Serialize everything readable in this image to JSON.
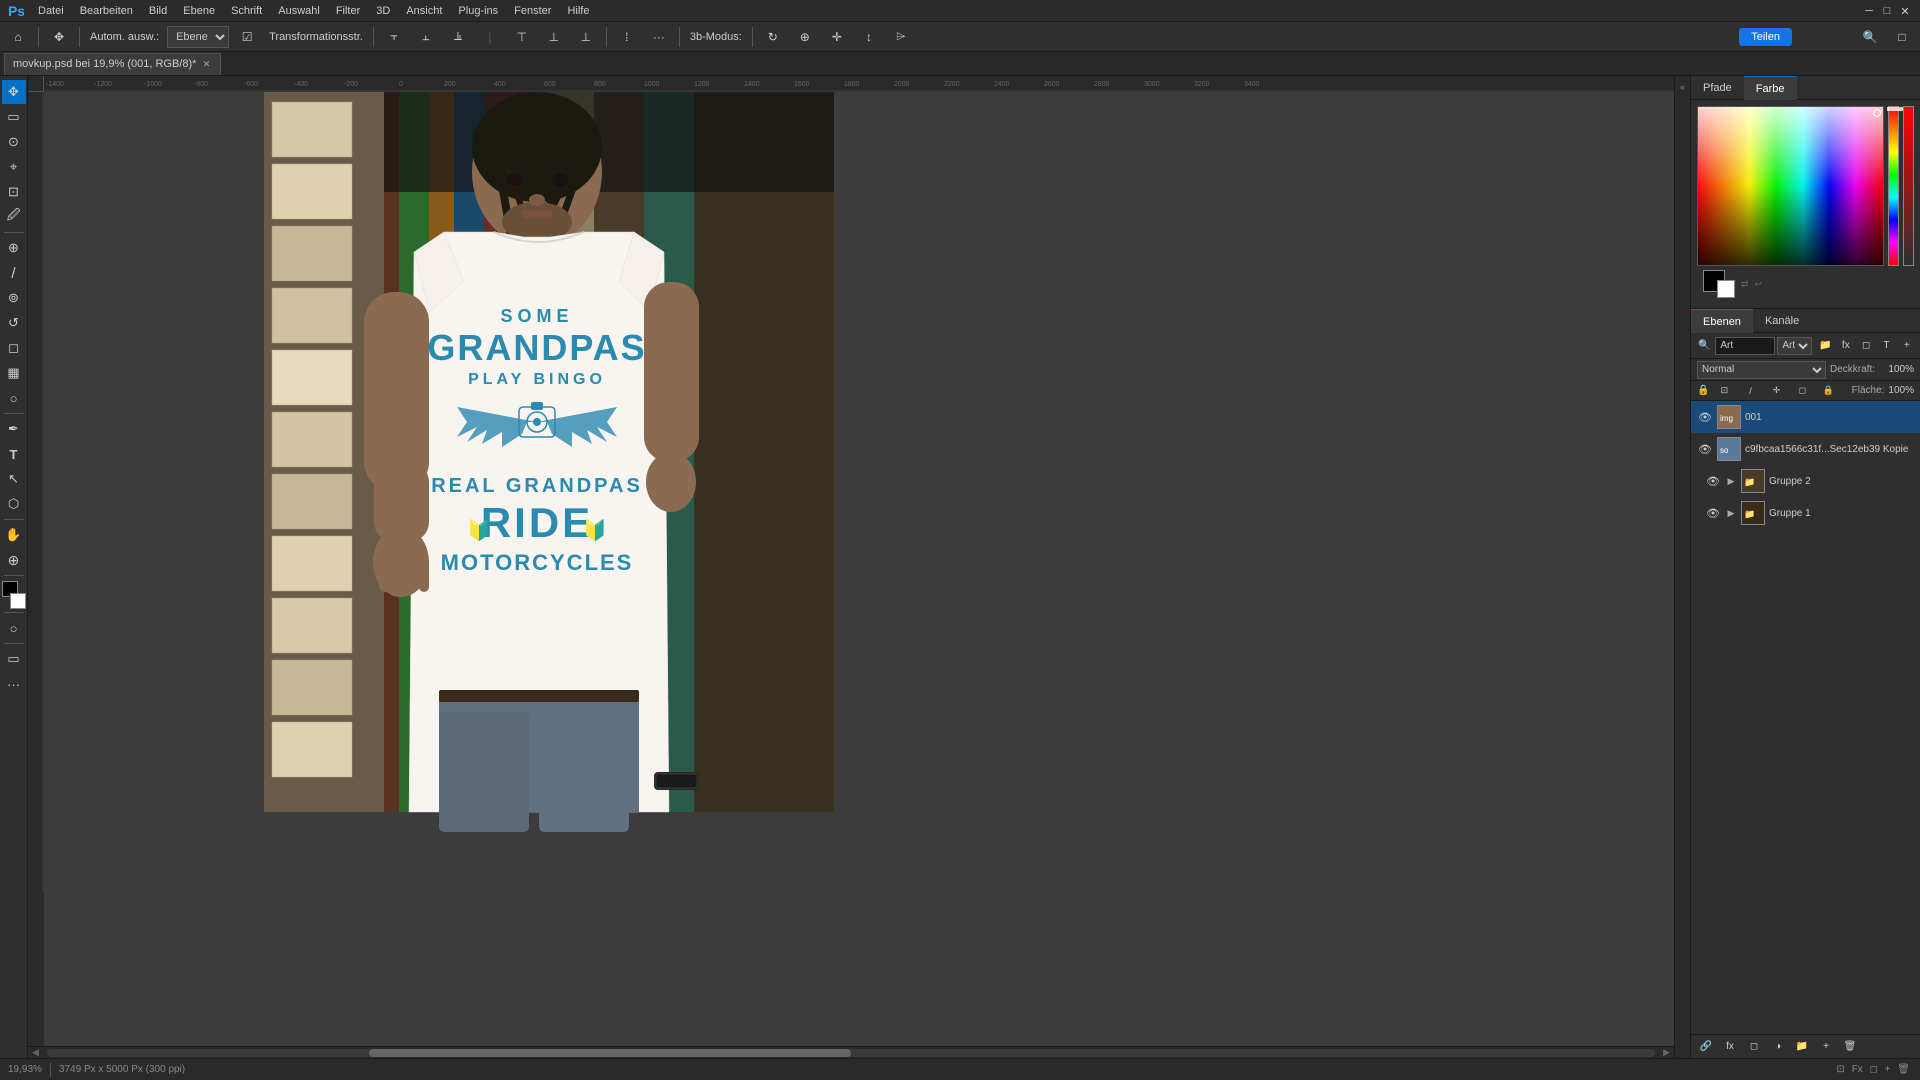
{
  "app": {
    "title": "Adobe Photoshop"
  },
  "window_controls": {
    "minimize": "─",
    "restore": "□",
    "close": "✕"
  },
  "menubar": {
    "items": [
      "Datei",
      "Bearbeiten",
      "Bild",
      "Ebene",
      "Schrift",
      "Auswahl",
      "Filter",
      "3D",
      "Ansicht",
      "Plug-ins",
      "Fenster",
      "Hilfe"
    ]
  },
  "toolbar": {
    "auto_select_label": "Autom. ausw.:",
    "layer_dropdown": "Ebene",
    "transform_label": "Transformationsstr.",
    "mode_label": "3b-Modus:",
    "share_button": "Teilen",
    "more_icon": "···"
  },
  "tab": {
    "filename": "movkup.psd bei 19,9% (001, RGB/8)*",
    "close_icon": "✕"
  },
  "canvas": {
    "zoom": "19,93%",
    "resolution": "3749 Px x 5000 Px (300 ppi)"
  },
  "tools": [
    {
      "name": "move",
      "icon": "✥"
    },
    {
      "name": "select-rect",
      "icon": "▭"
    },
    {
      "name": "lasso",
      "icon": "⊙"
    },
    {
      "name": "quick-select",
      "icon": "⌖"
    },
    {
      "name": "crop",
      "icon": "⊡"
    },
    {
      "name": "eyedropper",
      "icon": "🖉"
    },
    {
      "name": "heal",
      "icon": "⊕"
    },
    {
      "name": "brush",
      "icon": "/"
    },
    {
      "name": "clone",
      "icon": "⊚"
    },
    {
      "name": "history-brush",
      "icon": "↺"
    },
    {
      "name": "eraser",
      "icon": "◻"
    },
    {
      "name": "gradient",
      "icon": "▦"
    },
    {
      "name": "dodge",
      "icon": "○"
    },
    {
      "name": "pen",
      "icon": "✒"
    },
    {
      "name": "type",
      "icon": "T"
    },
    {
      "name": "path-select",
      "icon": "↖"
    },
    {
      "name": "shape",
      "icon": "⬡"
    },
    {
      "name": "hand",
      "icon": "✋"
    },
    {
      "name": "zoom",
      "icon": "⊕"
    },
    {
      "name": "foreground-color",
      "icon": ""
    },
    {
      "name": "background-color",
      "icon": ""
    }
  ],
  "right_panel": {
    "panels_collapse_icon": "«"
  },
  "color_panel": {
    "tabs": [
      "Pfade",
      "Farbe"
    ],
    "active_tab": "Farbe",
    "hue_slider_label": "",
    "foreground": "#000000",
    "background": "#ffffff"
  },
  "layers_panel": {
    "tabs": [
      "Ebenen",
      "Kanäle"
    ],
    "active_tab": "Ebenen",
    "search_placeholder": "Art",
    "blend_mode": "Normal",
    "opacity_label": "Deckkraft:",
    "opacity_value": "100%",
    "fill_label": "Fläche:",
    "fill_value": "100%",
    "layers": [
      {
        "id": "layer-001",
        "name": "001",
        "type": "smart-object",
        "visible": true,
        "selected": false,
        "thumb_color": "#8a6a50"
      },
      {
        "id": "layer-copy",
        "name": "c9fbcaa1566c31f...Sec12eb39 Kopie",
        "type": "smart-object",
        "visible": true,
        "selected": false,
        "thumb_color": "#5a7a9a"
      },
      {
        "id": "gruppe-2",
        "name": "Gruppe 2",
        "type": "group",
        "visible": true,
        "selected": false,
        "expanded": false
      },
      {
        "id": "gruppe-1",
        "name": "Gruppe 1",
        "type": "group",
        "visible": true,
        "selected": false,
        "expanded": false
      }
    ],
    "bottom_icons": [
      "add-layer",
      "delete-layer",
      "new-layer",
      "adjustment",
      "mask"
    ]
  },
  "status_bar": {
    "zoom": "19,93%",
    "dimensions": "3749 Px x 5000 Px (300 ppi)"
  },
  "tshirt_design": {
    "line1": "SOME",
    "line2": "GRANDPAS",
    "line3": "PLAY BINGO",
    "line4": "REAL GRANDPAS",
    "line5": "RIDE",
    "line6": "MOTORCYCLES"
  }
}
